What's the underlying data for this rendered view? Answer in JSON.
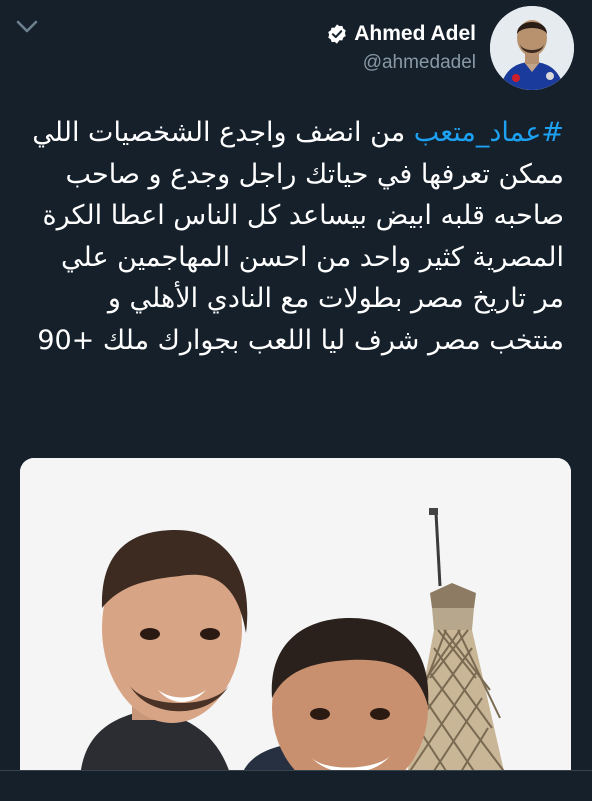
{
  "tweet": {
    "author": {
      "display_name": "Ahmed Adel",
      "handle": "@ahmedadel",
      "verified_icon": "verified-badge-icon",
      "avatar_icon": "avatar-photo"
    },
    "hashtag": "#عماد_متعب",
    "text_rest": " من انضف واجدع الشخصيات اللي ممكن تعرفها في حياتك راجل وجدع و صاحب صاحبه قلبه ابيض بيساعد كل الناس اعطا الكرة المصرية كثير واحد من احسن المهاجمين علي مر تاريخ مصر بطولات مع النادي الأهلي و منتخب مصر شرف ليا اللعب بجوارك ملك +90",
    "media_icon": "photo-two-men-cairo-tower"
  },
  "ui": {
    "menu_icon": "chevron-down-icon"
  },
  "colors": {
    "background": "#15202b",
    "hashtag": "#1da1f2",
    "secondary_text": "#8899a6"
  }
}
